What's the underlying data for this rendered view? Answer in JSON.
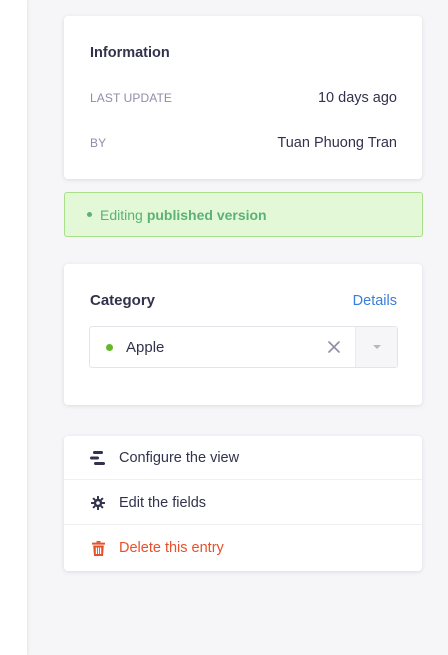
{
  "information": {
    "title": "Information",
    "last_update_label": "LAST UPDATE",
    "last_update_value": "10 days ago",
    "by_label": "BY",
    "by_value": "Tuan Phuong Tran"
  },
  "banner": {
    "prefix": "Editing",
    "emphasis": "published version",
    "color": "#5cb176"
  },
  "category": {
    "label": "Category",
    "details_link": "Details",
    "selected_value": "Apple",
    "dot_color": "#66b82b",
    "icons": [
      "clear-x-icon",
      "caret-down-icon"
    ]
  },
  "actions": [
    {
      "label": "Configure the view",
      "icon": "layout-bars-icon"
    },
    {
      "label": "Edit the fields",
      "icon": "gear-icon"
    },
    {
      "label": "Delete this entry",
      "icon": "trash-icon",
      "color": "#e8502a"
    }
  ]
}
